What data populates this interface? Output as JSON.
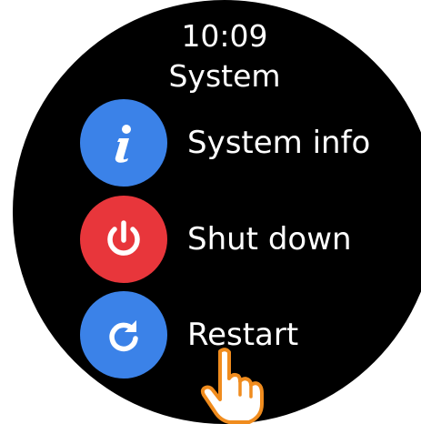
{
  "status": {
    "time": "10:09"
  },
  "screen": {
    "title": "System"
  },
  "menu": {
    "items": [
      {
        "label": "System info",
        "icon": "info-icon",
        "color": "#3b82e8"
      },
      {
        "label": "Shut down",
        "icon": "power-icon",
        "color": "#e8363b"
      },
      {
        "label": "Restart",
        "icon": "restart-icon",
        "color": "#3b82e8"
      }
    ]
  },
  "overlay": {
    "icon": "hand-pointer-icon",
    "color": "#f08c1e"
  }
}
